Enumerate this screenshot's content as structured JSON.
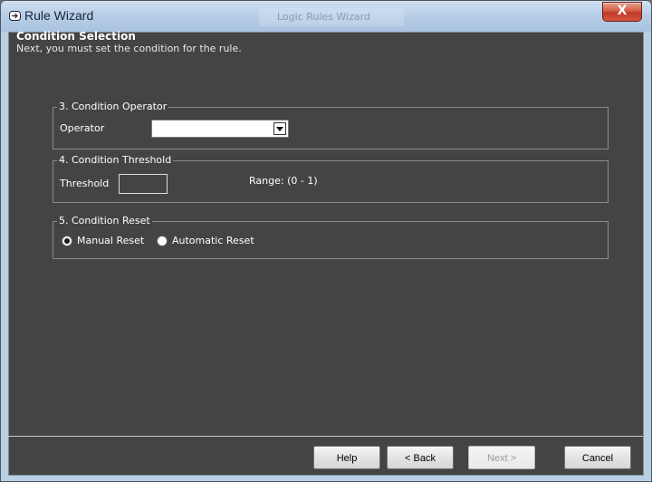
{
  "window": {
    "title": "Rule Wizard",
    "ghost_title": "Logic Rules Wizard",
    "close_glyph": "X"
  },
  "header": {
    "title": "Condition Selection",
    "subtitle": "Next, you must set the condition for the rule."
  },
  "groups": {
    "operator": {
      "legend": "3. Condition Operator",
      "label": "Operator",
      "value": ""
    },
    "threshold": {
      "legend": "4. Condition Threshold",
      "label": "Threshold",
      "value": "",
      "range": "Range: (0 - 1)"
    },
    "reset": {
      "legend": "5. Condition Reset",
      "manual_label": "Manual Reset",
      "automatic_label": "Automatic Reset",
      "selected": "manual"
    }
  },
  "buttons": {
    "help": "Help",
    "back": "< Back",
    "next": "Next >",
    "cancel": "Cancel"
  },
  "colors": {
    "panel_bg": "#444444",
    "frame": "#b9cfe4",
    "close_red": "#c0392b"
  }
}
